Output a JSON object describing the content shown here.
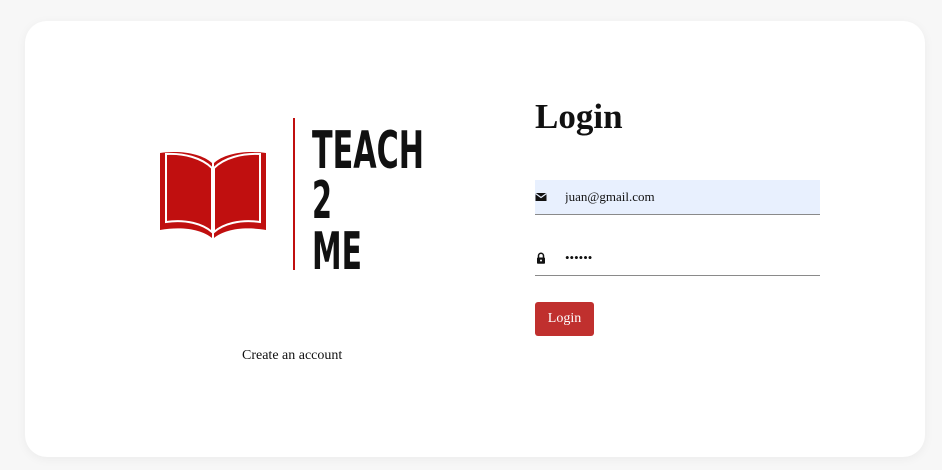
{
  "brand": {
    "logo_lines": [
      "TEACH",
      "2",
      "ME"
    ],
    "logo_color": "#c00f0f",
    "create_account_label": "Create an account"
  },
  "login": {
    "title": "Login",
    "email_value": "juan@gmail.com",
    "email_icon": "mail-icon",
    "password_value": "••••••",
    "password_icon": "lock-icon",
    "button_label": "Login",
    "button_color": "#c0302e"
  }
}
